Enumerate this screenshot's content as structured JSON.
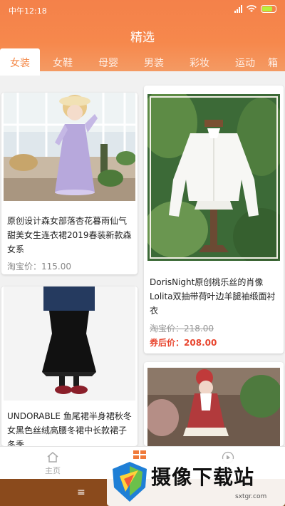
{
  "status": {
    "time": "中午12:18"
  },
  "header": {
    "title": "精选"
  },
  "tabs": [
    {
      "label": "女装",
      "active": true
    },
    {
      "label": "女鞋"
    },
    {
      "label": "母婴"
    },
    {
      "label": "男装"
    },
    {
      "label": "彩妆"
    },
    {
      "label": "运动"
    },
    {
      "label": "箱"
    }
  ],
  "products": [
    {
      "title": "原创设计森女部落杏花暮雨仙气甜美女生连衣裙2019春装新款森女系",
      "price_label": "淘宝价：",
      "price": "115.00"
    },
    {
      "title": "DorisNight原创桃乐丝的肖像Lolita双抽带荷叶边羊腿袖缎面衬衣",
      "price_label": "淘宝价：",
      "price": "218.00",
      "after_label": "券后价：",
      "after_price": "208.00"
    },
    {
      "title": "UNDORABLE 鱼尾裙半身裙秋冬女黑色丝绒高腰冬裙中长款裙子冬季"
    },
    {
      "title": ""
    }
  ],
  "nav": {
    "home": "主页"
  },
  "watermark": {
    "text": "摄像下载站",
    "url": "sxtgr.com"
  },
  "system": {
    "menu": "≡"
  },
  "colors": {
    "accent": "#f6884c",
    "price_red": "#e8452e"
  }
}
